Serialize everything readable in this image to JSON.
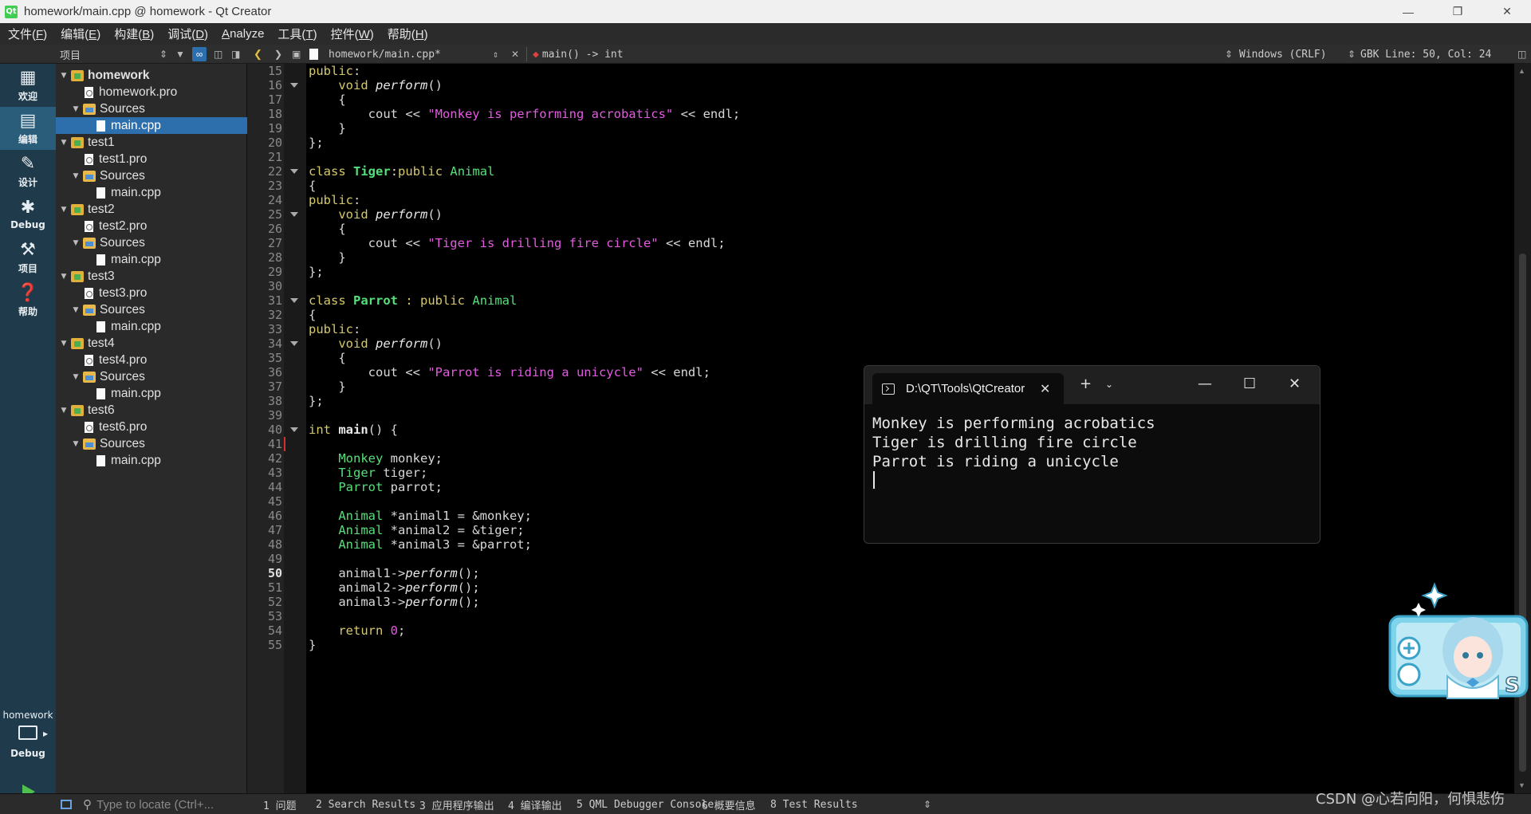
{
  "window": {
    "title": "homework/main.cpp @ homework - Qt Creator",
    "logo_text": "Qt"
  },
  "menubar": [
    {
      "label": "文件(",
      "key": "F",
      "tail": ")"
    },
    {
      "label": "编辑(",
      "key": "E",
      "tail": ")"
    },
    {
      "label": "构建(",
      "key": "B",
      "tail": ")"
    },
    {
      "label": "调试(",
      "key": "D",
      "tail": ")"
    },
    {
      "label": "",
      "key": "A",
      "tail": "nalyze"
    },
    {
      "label": "工具(",
      "key": "T",
      "tail": ")"
    },
    {
      "label": "控件(",
      "key": "W",
      "tail": ")"
    },
    {
      "label": "帮助(",
      "key": "H",
      "tail": ")"
    }
  ],
  "toolrow": {
    "project_selector": "项目",
    "file_tab": "homework/main.cpp*",
    "symbol": "main() -> int",
    "line_ending": "Windows (CRLF)",
    "encoding_position": "GBK Line: 50, Col: 24"
  },
  "modes": [
    {
      "label": "欢迎",
      "icon": "grid-icon"
    },
    {
      "label": "编辑",
      "icon": "edit-icon"
    },
    {
      "label": "设计",
      "icon": "pencil-icon"
    },
    {
      "label": "Debug",
      "icon": "bug-icon"
    },
    {
      "label": "项目",
      "icon": "wrench-icon"
    },
    {
      "label": "帮助",
      "icon": "help-icon"
    }
  ],
  "kit": {
    "project": "homework",
    "config": "Debug"
  },
  "tree": [
    {
      "depth": 0,
      "type": "proj",
      "label": "homework",
      "bold": true
    },
    {
      "depth": 1,
      "type": "pro",
      "label": "homework.pro"
    },
    {
      "depth": 1,
      "type": "folder",
      "label": "Sources"
    },
    {
      "depth": 2,
      "type": "file",
      "label": "main.cpp",
      "selected": true
    },
    {
      "depth": 0,
      "type": "proj",
      "label": "test1"
    },
    {
      "depth": 1,
      "type": "pro",
      "label": "test1.pro"
    },
    {
      "depth": 1,
      "type": "folder",
      "label": "Sources"
    },
    {
      "depth": 2,
      "type": "file",
      "label": "main.cpp"
    },
    {
      "depth": 0,
      "type": "proj",
      "label": "test2"
    },
    {
      "depth": 1,
      "type": "pro",
      "label": "test2.pro"
    },
    {
      "depth": 1,
      "type": "folder",
      "label": "Sources"
    },
    {
      "depth": 2,
      "type": "file",
      "label": "main.cpp"
    },
    {
      "depth": 0,
      "type": "proj",
      "label": "test3"
    },
    {
      "depth": 1,
      "type": "pro",
      "label": "test3.pro"
    },
    {
      "depth": 1,
      "type": "folder",
      "label": "Sources"
    },
    {
      "depth": 2,
      "type": "file",
      "label": "main.cpp"
    },
    {
      "depth": 0,
      "type": "proj",
      "label": "test4"
    },
    {
      "depth": 1,
      "type": "pro",
      "label": "test4.pro"
    },
    {
      "depth": 1,
      "type": "folder",
      "label": "Sources"
    },
    {
      "depth": 2,
      "type": "file",
      "label": "main.cpp"
    },
    {
      "depth": 0,
      "type": "proj",
      "label": "test6"
    },
    {
      "depth": 1,
      "type": "pro",
      "label": "test6.pro"
    },
    {
      "depth": 1,
      "type": "folder",
      "label": "Sources"
    },
    {
      "depth": 2,
      "type": "file",
      "label": "main.cpp"
    }
  ],
  "editor": {
    "current_line": 50,
    "first_line": 15,
    "fold_lines": [
      16,
      22,
      25,
      31,
      34,
      40
    ],
    "lines": [
      [
        [
          "kw",
          "public"
        ],
        [
          "p",
          ":"
        ]
      ],
      [
        [
          "p",
          "    "
        ],
        [
          "kw",
          "void"
        ],
        [
          "p",
          " "
        ],
        [
          "fn",
          "perform"
        ],
        [
          "p",
          "()"
        ]
      ],
      [
        [
          "p",
          "    {"
        ]
      ],
      [
        [
          "p",
          "        cout << "
        ],
        [
          "str",
          "\"Monkey is performing acrobatics\""
        ],
        [
          "p",
          " << endl;"
        ]
      ],
      [
        [
          "p",
          "    }"
        ]
      ],
      [
        [
          "p",
          "};"
        ]
      ],
      [],
      [
        [
          "kw",
          "class"
        ],
        [
          "p",
          " "
        ],
        [
          "cls",
          "Tiger"
        ],
        [
          "p",
          ":"
        ],
        [
          "kw",
          "public"
        ],
        [
          "p",
          " "
        ],
        [
          "ty",
          "Animal"
        ]
      ],
      [
        [
          "p",
          "{"
        ]
      ],
      [
        [
          "kw",
          "public"
        ],
        [
          "p",
          ":"
        ]
      ],
      [
        [
          "p",
          "    "
        ],
        [
          "kw",
          "void"
        ],
        [
          "p",
          " "
        ],
        [
          "fn",
          "perform"
        ],
        [
          "p",
          "()"
        ]
      ],
      [
        [
          "p",
          "    {"
        ]
      ],
      [
        [
          "p",
          "        cout << "
        ],
        [
          "str",
          "\"Tiger is drilling fire circle\""
        ],
        [
          "p",
          " << endl;"
        ]
      ],
      [
        [
          "p",
          "    }"
        ]
      ],
      [
        [
          "p",
          "};"
        ]
      ],
      [],
      [
        [
          "kw",
          "class"
        ],
        [
          "p",
          " "
        ],
        [
          "cls",
          "Parrot"
        ],
        [
          "p",
          " "
        ],
        [
          "kw",
          ": public"
        ],
        [
          "p",
          " "
        ],
        [
          "ty",
          "Animal"
        ]
      ],
      [
        [
          "p",
          "{"
        ]
      ],
      [
        [
          "kw",
          "public"
        ],
        [
          "p",
          ":"
        ]
      ],
      [
        [
          "p",
          "    "
        ],
        [
          "kw",
          "void"
        ],
        [
          "p",
          " "
        ],
        [
          "fn",
          "perform"
        ],
        [
          "p",
          "()"
        ]
      ],
      [
        [
          "p",
          "    {"
        ]
      ],
      [
        [
          "p",
          "        cout << "
        ],
        [
          "str",
          "\"Parrot is riding a unicycle\""
        ],
        [
          "p",
          " << endl;"
        ]
      ],
      [
        [
          "p",
          "    }"
        ]
      ],
      [
        [
          "p",
          "};"
        ]
      ],
      [],
      [
        [
          "kw",
          "int"
        ],
        [
          "p",
          " "
        ],
        [
          "fnb",
          "main"
        ],
        [
          "p",
          "() {"
        ]
      ],
      [],
      [
        [
          "p",
          "    "
        ],
        [
          "ty",
          "Monkey"
        ],
        [
          "p",
          " monkey;"
        ]
      ],
      [
        [
          "p",
          "    "
        ],
        [
          "ty",
          "Tiger"
        ],
        [
          "p",
          " tiger;"
        ]
      ],
      [
        [
          "p",
          "    "
        ],
        [
          "ty",
          "Parrot"
        ],
        [
          "p",
          " parrot;"
        ]
      ],
      [],
      [
        [
          "p",
          "    "
        ],
        [
          "ty",
          "Animal"
        ],
        [
          "p",
          " *animal1 = &monkey;"
        ]
      ],
      [
        [
          "p",
          "    "
        ],
        [
          "ty",
          "Animal"
        ],
        [
          "p",
          " *animal2 = &tiger;"
        ]
      ],
      [
        [
          "p",
          "    "
        ],
        [
          "ty",
          "Animal"
        ],
        [
          "p",
          " *animal3 = &parrot;"
        ]
      ],
      [],
      [
        [
          "p",
          "    animal1->"
        ],
        [
          "fn",
          "perform"
        ],
        [
          "p",
          "();"
        ]
      ],
      [
        [
          "p",
          "    animal2->"
        ],
        [
          "fn",
          "perform"
        ],
        [
          "p",
          "();"
        ]
      ],
      [
        [
          "p",
          "    animal3->"
        ],
        [
          "fn",
          "perform"
        ],
        [
          "p",
          "();"
        ]
      ],
      [],
      [
        [
          "p",
          "    "
        ],
        [
          "kw",
          "return"
        ],
        [
          "p",
          " "
        ],
        [
          "num",
          "0"
        ],
        [
          "p",
          ";"
        ]
      ],
      [
        [
          "p",
          "}"
        ]
      ]
    ]
  },
  "terminal": {
    "tab_title": "D:\\QT\\Tools\\QtCreator",
    "output": [
      "Monkey is performing acrobatics",
      "Tiger is drilling fire circle",
      "Parrot is riding a unicycle"
    ]
  },
  "bottombar": {
    "locate_placeholder": "Type to locate (Ctrl+...",
    "panes": [
      "1 问题",
      "2 Search Results",
      "3 应用程序输出",
      "4 编译输出",
      "5 QML Debugger Console",
      "6 概要信息",
      "8 Test Results"
    ]
  },
  "watermark": "CSDN @心若向阳，何惧悲伤",
  "colors": {
    "keyword": "#d6c96a",
    "type": "#55e07a",
    "string": "#e25be0",
    "selection": "#2d6fad",
    "mode_bar": "#1f3a4a"
  }
}
